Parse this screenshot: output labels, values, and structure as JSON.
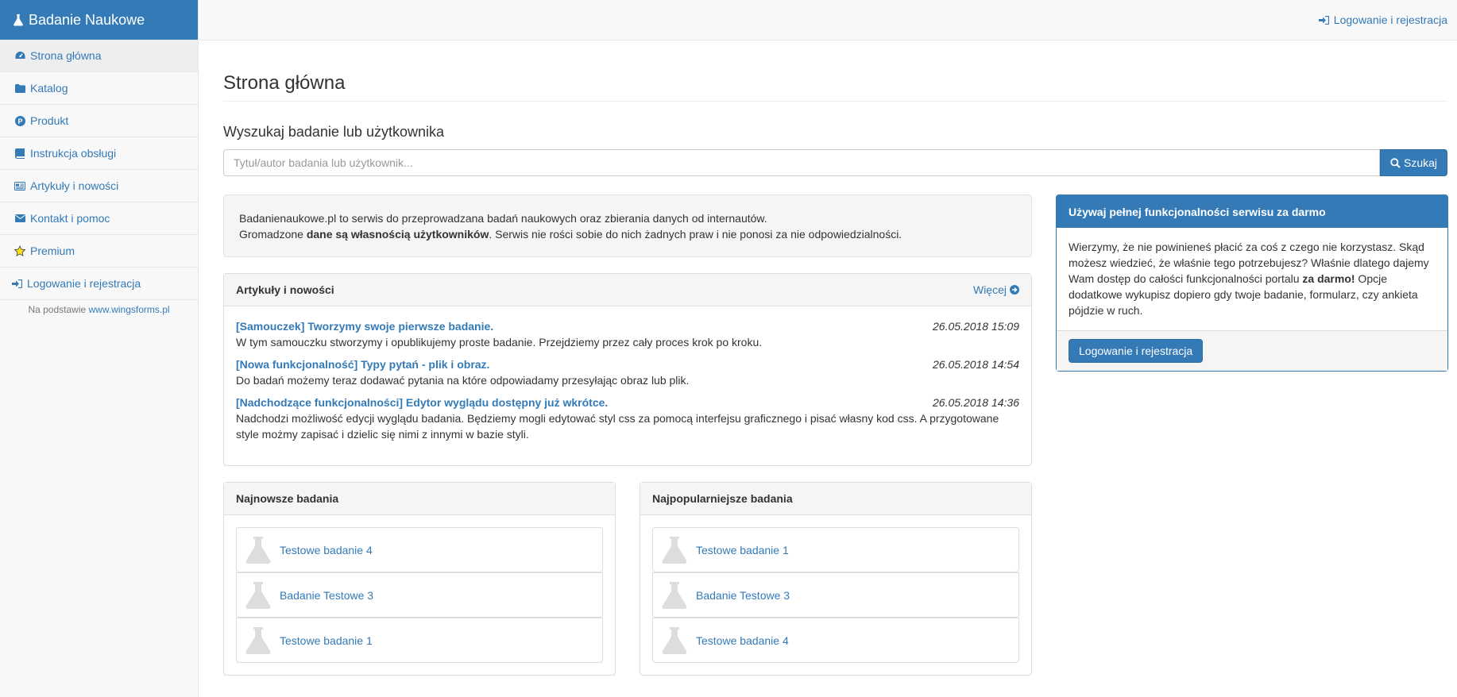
{
  "brand": {
    "title": "Badanie Naukowe",
    "icon": "flask-icon"
  },
  "sidebar": {
    "items": [
      {
        "label": "Strona główna",
        "icon": "dashboard-icon"
      },
      {
        "label": "Katalog",
        "icon": "folder-icon"
      },
      {
        "label": "Produkt",
        "icon": "product-p-icon"
      },
      {
        "label": "Instrukcja obsługi",
        "icon": "book-icon"
      },
      {
        "label": "Artykuły i nowości",
        "icon": "newspaper-icon"
      },
      {
        "label": "Kontakt i pomoc",
        "icon": "envelope-icon"
      },
      {
        "label": "Premium",
        "icon": "star-icon"
      },
      {
        "label": "Logowanie i rejestracja",
        "icon": "sign-in-icon"
      }
    ],
    "credit_prefix": "Na podstawie",
    "credit_link": "www.wingsforms.pl"
  },
  "topbar": {
    "login_label": "Logowanie i rejestracja"
  },
  "main": {
    "title": "Strona główna",
    "search_title": "Wyszukaj badanie lub użytkownika",
    "search_placeholder": "Tytuł/autor badania lub użytkownik...",
    "search_button": "Szukaj"
  },
  "info": {
    "line1": "Badanienaukowe.pl to serwis do przeprowadzana badań naukowych oraz zbierania danych od internautów.",
    "line2_prefix": "Gromadzone ",
    "line2_bold": "dane są własnością użytkowników",
    "line2_suffix": ". Serwis nie rości sobie do nich żadnych praw i nie ponosi za nie odpowiedzialności."
  },
  "articles": {
    "heading": "Artykuły i nowości",
    "more": "Więcej",
    "items": [
      {
        "title": "[Samouczek] Tworzymy swoje pierwsze badanie.",
        "date": "26.05.2018 15:09",
        "text": "W tym samouczku stworzymy i opublikujemy proste badanie. Przejdziemy przez cały proces krok po kroku."
      },
      {
        "title": "[Nowa funkcjonalność] Typy pytań - plik i obraz.",
        "date": "26.05.2018 14:54",
        "text": "Do badań możemy teraz dodawać pytania na które odpowiadamy przesyłając obraz lub plik."
      },
      {
        "title": "[Nadchodzące funkcjonalności] Edytor wyglądu dostępny już wkrótce.",
        "date": "26.05.2018 14:36",
        "text": "Nadchodzi możliwość edycji wyglądu badania. Będziemy mogli edytować styl css za pomocą interfejsu graficznego i pisać własny kod css. A przygotowane style możmy zapisać i dzielic się nimi z innymi w bazie styli."
      }
    ]
  },
  "newest": {
    "heading": "Najnowsze badania",
    "items": [
      "Testowe badanie 4",
      "Badanie Testowe 3",
      "Testowe badanie 1"
    ]
  },
  "popular": {
    "heading": "Najpopularniejsze badania",
    "items": [
      "Testowe badanie 1",
      "Badanie Testowe 3",
      "Testowe badanie 4"
    ]
  },
  "promo": {
    "heading": "Używaj pełnej funkcjonalności serwisu za darmo",
    "text_prefix": "Wierzymy, że nie powinieneś płacić za coś z czego nie korzystasz. Skąd możesz wiedzieć, że właśnie tego potrzebujesz? Właśnie dlatego dajemy Wam dostęp do całości funkcjonalności portalu ",
    "text_bold": "za darmo!",
    "text_suffix": " Opcje dodatkowe wykupisz dopiero gdy twoje badanie, formularz, czy ankieta pójdzie w ruch.",
    "button": "Logowanie i rejestracja"
  },
  "colors": {
    "primary": "#337ab7",
    "sidebar_bg": "#f8f8f8",
    "panel_bg": "#f5f5f5"
  }
}
